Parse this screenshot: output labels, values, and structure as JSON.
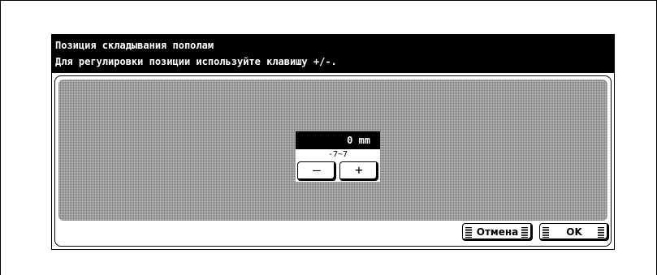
{
  "header": {
    "title": "Позиция складывания пополам",
    "instruction": "Для регулировки позиции используйте клавишу  +/-."
  },
  "adjustment": {
    "value_display": "0 mm",
    "range": "-7~7",
    "minus_label": "–",
    "plus_label": "+"
  },
  "footer": {
    "cancel_label": "Отмена",
    "ok_label": "OK"
  }
}
